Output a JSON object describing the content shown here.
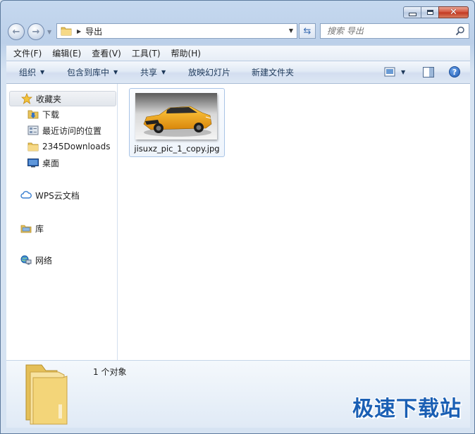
{
  "window": {
    "minimize_icon": "minimize-icon",
    "maximize_icon": "maximize-icon",
    "close_icon": "close-icon"
  },
  "navigation": {
    "back_icon": "back-arrow-icon",
    "forward_icon": "forward-arrow-icon",
    "address_crumb": "导出",
    "refresh_icon": "refresh-icon",
    "search_placeholder": "搜索 导出"
  },
  "menubar": {
    "items": [
      "文件(F)",
      "编辑(E)",
      "查看(V)",
      "工具(T)",
      "帮助(H)"
    ]
  },
  "toolbar": {
    "organize": "组织",
    "include_in_library": "包含到库中",
    "share": "共享",
    "slideshow": "放映幻灯片",
    "new_folder": "新建文件夹",
    "view_icon": "view-options-icon",
    "preview_icon": "preview-pane-icon",
    "help_label": "?"
  },
  "sidebar": {
    "favorites": "收藏夹",
    "downloads": "下载",
    "recent": "最近访问的位置",
    "downloads2345": "2345Downloads",
    "desktop": "桌面",
    "wps": "WPS云文档",
    "library": "库",
    "network": "网络"
  },
  "files": [
    {
      "name": "jisuxz_pic_1_copy.jpg",
      "type": "jpg"
    }
  ],
  "status": {
    "count": "1 个对象"
  },
  "watermark": "极速下载站",
  "colors": {
    "accent": "#1a5fb4",
    "car_body": "#f5a614",
    "close_red": "#c2361f"
  }
}
